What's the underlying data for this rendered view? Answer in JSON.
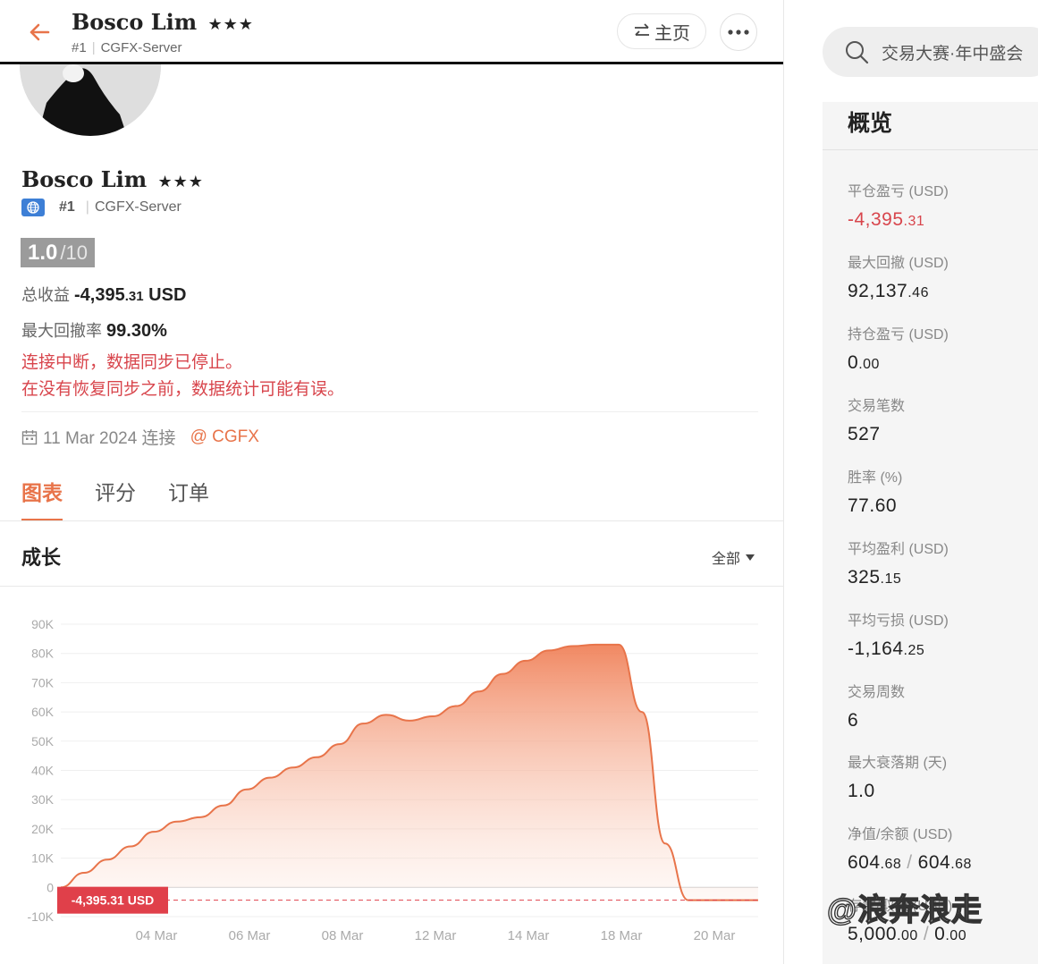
{
  "header": {
    "name": "Bosco Lim",
    "stars": "★★★",
    "rank": "#1",
    "server": "CGFX-Server",
    "home_label": "主页"
  },
  "profile": {
    "name": "Bosco Lim",
    "stars": "★★★",
    "rank": "#1",
    "server": "CGFX-Server",
    "score": "1.0",
    "score_den": "/10",
    "total_label": "总收益",
    "total_int": "-4,395",
    "total_dec": ".31",
    "total_unit": "USD",
    "dd_label": "最大回撤率",
    "dd_value": "99.30%",
    "warning1": "连接中断，数据同步已停止。",
    "warning2": "在没有恢复同步之前，数据统计可能有误。",
    "connect_text": "11 Mar 2024 连接",
    "connect_broker": "@ CGFX"
  },
  "tabs": [
    {
      "label": "图表",
      "active": true
    },
    {
      "label": "评分",
      "active": false
    },
    {
      "label": "订单",
      "active": false
    }
  ],
  "growth": {
    "title": "成长",
    "filter": "全部"
  },
  "chart_data": {
    "type": "area",
    "title": "成长",
    "ylim": [
      -10000,
      90000
    ],
    "yticks": [
      "90K",
      "80K",
      "70K",
      "60K",
      "50K",
      "40K",
      "30K",
      "20K",
      "10K",
      "0",
      "-10K"
    ],
    "xticks": [
      "04 Mar",
      "06 Mar",
      "08 Mar",
      "12 Mar",
      "14 Mar",
      "18 Mar",
      "20 Mar"
    ],
    "current_label": "-4,395.31 USD",
    "current_value": -4395.31,
    "series": [
      {
        "values": [
          0,
          5000,
          9500,
          14000,
          19000,
          22500,
          24000,
          28000,
          33500,
          37500,
          41000,
          44500,
          49000,
          56000,
          59000,
          57000,
          58500,
          62000,
          67000,
          73000,
          77500,
          81000,
          82500,
          83000,
          83000,
          60000,
          15000,
          -4395,
          -4395,
          -4395,
          -4395
        ]
      }
    ],
    "colors": {
      "line": "#e8744a",
      "fill_top": "#f0825a",
      "current": "#e0404a"
    }
  },
  "search": {
    "placeholder": "交易大赛·年中盛会"
  },
  "overview": {
    "title": "概览",
    "items": [
      {
        "label": "平仓盈亏 (USD)",
        "int": "-4,395",
        "dec": ".31",
        "neg": true
      },
      {
        "label": "最大回撤 (USD)",
        "int": "92,137",
        "dec": ".46"
      },
      {
        "label": "持仓盈亏 (USD)",
        "int": "0",
        "dec": ".00"
      },
      {
        "label": "交易笔数",
        "int": "527",
        "dec": ""
      },
      {
        "label": "胜率 (%)",
        "int": "77.60",
        "dec": ""
      },
      {
        "label": "平均盈利 (USD)",
        "int": "325",
        "dec": ".15"
      },
      {
        "label": "平均亏损 (USD)",
        "int": "-1,164",
        "dec": ".25"
      },
      {
        "label": "交易周数",
        "int": "6",
        "dec": ""
      },
      {
        "label": "最大衰落期 (天)",
        "int": "1.0",
        "dec": ""
      },
      {
        "label": "净值/余额 (USD)",
        "int": "604",
        "dec": ".68",
        "int2": "604",
        "dec2": ".68"
      },
      {
        "label": "存款/取款 (USD)",
        "int": "5,000",
        "dec": ".00",
        "int2": "0",
        "dec2": ".00"
      }
    ]
  },
  "watermark": "@浪奔浪走"
}
